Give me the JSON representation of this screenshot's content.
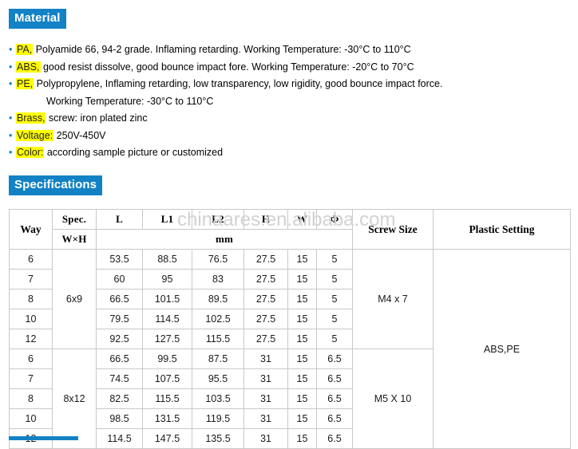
{
  "sections": {
    "material": {
      "heading": "Material",
      "bullet_glyph": "•",
      "items": [
        {
          "highlight": "PA,",
          "text": " Polyamide 66, 94-2 grade. Inflaming retarding. Working Temperature:  -30°C to 110°C",
          "sub": ""
        },
        {
          "highlight": "ABS,",
          "text": " good resist dissolve, good bounce impact fore. Working Temperature: -20°C to 70°C",
          "sub": ""
        },
        {
          "highlight": "PE,",
          "text": " Polypropylene, Inflaming retarding, low transparency, low rigidity, good bounce impact force.",
          "sub": "Working Temperature:   -30°C to 110°C"
        },
        {
          "highlight": "Brass,",
          "text": " screw:  iron plated zinc",
          "sub": ""
        },
        {
          "highlight": "Voltage:",
          "text": "  250V-450V",
          "sub": ""
        },
        {
          "highlight": "Color:",
          "text": "  according sample picture or customized",
          "sub": ""
        }
      ]
    },
    "specifications": {
      "heading": "Specifications",
      "watermark": "chinaares.en.alibaba.com",
      "table": {
        "headers_row1": [
          "Way",
          "Spec.",
          "L",
          "L1",
          "L2",
          "H",
          "W",
          "Φ",
          "Screw Size",
          "Plastic Setting"
        ],
        "headers_row2": [
          "W×H",
          "mm"
        ],
        "groups": [
          {
            "spec": "6x9",
            "screw_size": "M4 x 7",
            "rows": [
              {
                "way": "6",
                "L": "53.5",
                "L1": "88.5",
                "L2": "76.5",
                "H": "27.5",
                "W": "15",
                "phi": "5"
              },
              {
                "way": "7",
                "L": "60",
                "L1": "95",
                "L2": "83",
                "H": "27.5",
                "W": "15",
                "phi": "5"
              },
              {
                "way": "8",
                "L": "66.5",
                "L1": "101.5",
                "L2": "89.5",
                "H": "27.5",
                "W": "15",
                "phi": "5"
              },
              {
                "way": "10",
                "L": "79.5",
                "L1": "114.5",
                "L2": "102.5",
                "H": "27.5",
                "W": "15",
                "phi": "5"
              },
              {
                "way": "12",
                "L": "92.5",
                "L1": "127.5",
                "L2": "115.5",
                "H": "27.5",
                "W": "15",
                "phi": "5"
              }
            ]
          },
          {
            "spec": "8x12",
            "screw_size": "M5 X 10",
            "rows": [
              {
                "way": "6",
                "L": "66.5",
                "L1": "99.5",
                "L2": "87.5",
                "H": "31",
                "W": "15",
                "phi": "6.5"
              },
              {
                "way": "7",
                "L": "74.5",
                "L1": "107.5",
                "L2": "95.5",
                "H": "31",
                "W": "15",
                "phi": "6.5"
              },
              {
                "way": "8",
                "L": "82.5",
                "L1": "115.5",
                "L2": "103.5",
                "H": "31",
                "W": "15",
                "phi": "6.5"
              },
              {
                "way": "10",
                "L": "98.5",
                "L1": "131.5",
                "L2": "119.5",
                "H": "31",
                "W": "15",
                "phi": "6.5"
              },
              {
                "way": "12",
                "L": "114.5",
                "L1": "147.5",
                "L2": "135.5",
                "H": "31",
                "W": "15",
                "phi": "6.5"
              }
            ]
          }
        ],
        "plastic_setting": "ABS,PE"
      }
    }
  },
  "colors": {
    "heading_blue": "#1282c5",
    "highlight_yellow": "#ffff00",
    "table_border": "#c9c9c9",
    "watermark_gray": "#d2d2d2"
  }
}
